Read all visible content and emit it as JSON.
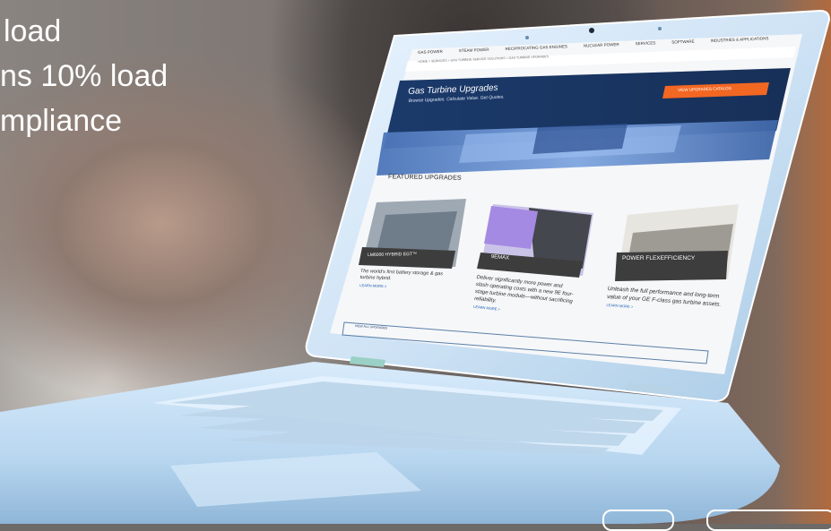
{
  "headline": {
    "line1": "load",
    "line2": "ns 10% load",
    "line3": "mpliance"
  },
  "screen": {
    "nav": [
      "GAS POWER",
      "STEAM POWER",
      "RECIPROCATING GAS ENGINES",
      "NUCLEAR POWER",
      "SERVICES",
      "SOFTWARE",
      "INDUSTRIES & APPLICATIONS"
    ],
    "breadcrumb": "HOME > SERVICES > GAS TURBINE SERVICE SOLUTIONS > GAS TURBINE UPGRADES",
    "hero_title": "Gas Turbine Upgrades",
    "hero_subtitle": "Browse Upgrades. Calculate Value. Get Quotes.",
    "catalog_button": "VIEW UPGRADES CATALOG",
    "featured_heading": "FEATURED UPGRADES",
    "cards": [
      {
        "label": "LM6000 HYBRID EGT™",
        "desc": "The world's first battery storage & gas turbine hybrid.",
        "link": "LEARN MORE  >"
      },
      {
        "label": "9EMAX",
        "desc": "Deliver significantly more power and slash operating costs with a new 9E four-stage turbine module—without sacrificing reliability.",
        "link": "LEARN MORE  >"
      },
      {
        "label": "POWER FLEXEFFICIENCY",
        "desc": "Unleash the full performance and long-term value of your GE F-class gas turbine assets.",
        "link": "LEARN MORE  >"
      }
    ],
    "view_all": "VIEW ALL UPGRADES"
  },
  "colors": {
    "hero_bg": "#1b3a6b",
    "accent": "#f26722",
    "card_label_bg": "#3d3d3d",
    "laptop_body": "#cfe3f5"
  }
}
